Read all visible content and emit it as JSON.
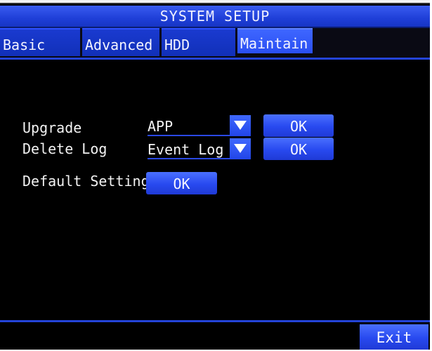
{
  "header": {
    "title": "SYSTEM SETUP"
  },
  "tabs": [
    {
      "label": "Basic"
    },
    {
      "label": "Advanced"
    },
    {
      "label": "HDD"
    },
    {
      "label": "Maintain",
      "active": true
    }
  ],
  "upgrade": {
    "label": "Upgrade",
    "selected": "APP",
    "ok_label": "OK"
  },
  "delete_log": {
    "label": "Delete Log",
    "selected": "Event Log",
    "ok_label": "OK"
  },
  "default_setting": {
    "label": "Default Setting",
    "ok_label": "OK"
  },
  "footer": {
    "exit_label": "Exit"
  },
  "colors": {
    "accent": "#2a4ff2",
    "tab": "#1130b8",
    "background": "#000000"
  }
}
